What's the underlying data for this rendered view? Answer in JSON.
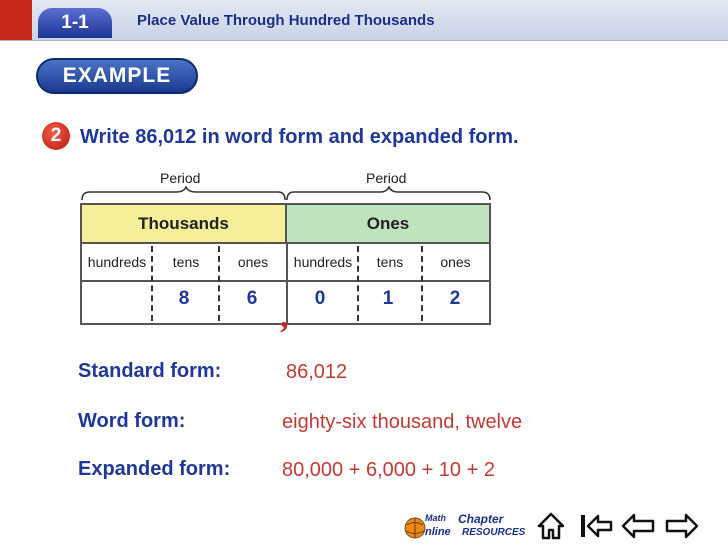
{
  "header": {
    "lesson": "1-1",
    "title": "Place Value Through Hundred Thousands"
  },
  "example_label": "EXAMPLE",
  "example_number": "2",
  "question": "Write 86,012 in word form and expanded form.",
  "table": {
    "period_label": "Period",
    "periods": [
      "Thousands",
      "Ones"
    ],
    "columns": [
      "hundreds",
      "tens",
      "ones",
      "hundreds",
      "tens",
      "ones"
    ],
    "digits": [
      "",
      "8",
      "6",
      "0",
      "1",
      "2"
    ]
  },
  "forms": {
    "standard_label": "Standard form:",
    "standard_value": "86,012",
    "word_label": "Word form:",
    "word_value": "eighty-six thousand, twelve",
    "expanded_label": "Expanded form:",
    "expanded_value": "80,000 + 6,000 + 10 + 2"
  },
  "nav": {
    "math_logo_top": "Math",
    "math_logo_bottom": "nline",
    "chapter_top": "Chapter",
    "chapter_bottom": "RESOURCES",
    "icons": [
      "home-icon",
      "first-slide-icon",
      "previous-icon",
      "next-icon"
    ]
  },
  "colors": {
    "title_blue": "#1f3799",
    "answer_red": "#c23a35",
    "thousands_yellow": "#f5ef9a",
    "ones_green": "#bfe3bf"
  }
}
